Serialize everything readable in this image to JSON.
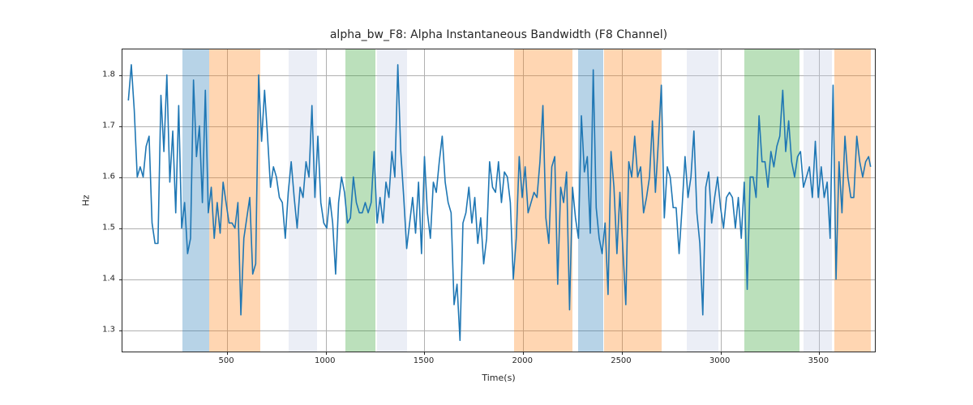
{
  "chart_data": {
    "type": "line",
    "title": "alpha_bw_F8: Alpha Instantaneous Bandwidth (F8 Channel)",
    "xlabel": "Time(s)",
    "ylabel": "Hz",
    "xlim": [
      -30,
      3790
    ],
    "ylim": [
      1.255,
      1.85
    ],
    "xticks": [
      500,
      1000,
      1500,
      2000,
      2500,
      3000,
      3500
    ],
    "yticks": [
      1.3,
      1.4,
      1.5,
      1.6,
      1.7,
      1.8
    ],
    "bands": [
      {
        "start": 275,
        "end": 410,
        "color": "blue"
      },
      {
        "start": 410,
        "end": 670,
        "color": "orange"
      },
      {
        "start": 810,
        "end": 955,
        "color": "lav"
      },
      {
        "start": 1100,
        "end": 1250,
        "color": "green"
      },
      {
        "start": 1260,
        "end": 1410,
        "color": "lav"
      },
      {
        "start": 1955,
        "end": 2250,
        "color": "orange"
      },
      {
        "start": 2280,
        "end": 2405,
        "color": "blue"
      },
      {
        "start": 2410,
        "end": 2700,
        "color": "orange"
      },
      {
        "start": 2830,
        "end": 2990,
        "color": "lav"
      },
      {
        "start": 3120,
        "end": 3400,
        "color": "green"
      },
      {
        "start": 3420,
        "end": 3565,
        "color": "lav"
      },
      {
        "start": 3575,
        "end": 3760,
        "color": "orange"
      }
    ],
    "x": [
      0,
      15,
      30,
      45,
      60,
      75,
      90,
      105,
      120,
      135,
      150,
      165,
      180,
      195,
      210,
      225,
      240,
      255,
      270,
      285,
      300,
      315,
      330,
      345,
      360,
      375,
      390,
      405,
      420,
      435,
      450,
      465,
      480,
      495,
      510,
      525,
      540,
      555,
      570,
      585,
      600,
      615,
      630,
      645,
      660,
      675,
      690,
      705,
      720,
      735,
      750,
      765,
      780,
      795,
      810,
      825,
      840,
      855,
      870,
      885,
      900,
      915,
      930,
      945,
      960,
      975,
      990,
      1005,
      1020,
      1035,
      1050,
      1065,
      1080,
      1095,
      1110,
      1125,
      1140,
      1155,
      1170,
      1185,
      1200,
      1215,
      1230,
      1245,
      1260,
      1275,
      1290,
      1305,
      1320,
      1335,
      1350,
      1365,
      1380,
      1395,
      1410,
      1425,
      1440,
      1455,
      1470,
      1485,
      1500,
      1515,
      1530,
      1545,
      1560,
      1575,
      1590,
      1605,
      1620,
      1635,
      1650,
      1665,
      1680,
      1695,
      1710,
      1725,
      1740,
      1755,
      1770,
      1785,
      1800,
      1815,
      1830,
      1845,
      1860,
      1875,
      1890,
      1905,
      1920,
      1935,
      1950,
      1965,
      1980,
      1995,
      2010,
      2025,
      2040,
      2055,
      2070,
      2085,
      2100,
      2115,
      2130,
      2145,
      2160,
      2175,
      2190,
      2205,
      2220,
      2235,
      2250,
      2265,
      2280,
      2295,
      2310,
      2325,
      2340,
      2355,
      2370,
      2385,
      2400,
      2415,
      2430,
      2445,
      2460,
      2475,
      2490,
      2505,
      2520,
      2535,
      2550,
      2565,
      2580,
      2595,
      2610,
      2625,
      2640,
      2655,
      2670,
      2685,
      2700,
      2715,
      2730,
      2745,
      2760,
      2775,
      2790,
      2805,
      2820,
      2835,
      2850,
      2865,
      2880,
      2895,
      2910,
      2925,
      2940,
      2955,
      2970,
      2985,
      3000,
      3015,
      3030,
      3045,
      3060,
      3075,
      3090,
      3105,
      3120,
      3135,
      3150,
      3165,
      3180,
      3195,
      3210,
      3225,
      3240,
      3255,
      3270,
      3285,
      3300,
      3315,
      3330,
      3345,
      3360,
      3375,
      3390,
      3405,
      3420,
      3435,
      3450,
      3465,
      3480,
      3495,
      3510,
      3525,
      3540,
      3555,
      3570,
      3585,
      3600,
      3615,
      3630,
      3645,
      3660,
      3675,
      3690,
      3705,
      3720,
      3735,
      3750,
      3760
    ],
    "values": [
      1.75,
      1.82,
      1.73,
      1.6,
      1.62,
      1.6,
      1.66,
      1.68,
      1.51,
      1.47,
      1.47,
      1.76,
      1.65,
      1.8,
      1.59,
      1.69,
      1.53,
      1.74,
      1.5,
      1.55,
      1.45,
      1.48,
      1.79,
      1.64,
      1.7,
      1.55,
      1.77,
      1.53,
      1.58,
      1.48,
      1.55,
      1.49,
      1.59,
      1.55,
      1.51,
      1.51,
      1.5,
      1.55,
      1.33,
      1.48,
      1.52,
      1.56,
      1.41,
      1.43,
      1.8,
      1.67,
      1.77,
      1.68,
      1.58,
      1.62,
      1.6,
      1.56,
      1.55,
      1.48,
      1.57,
      1.63,
      1.56,
      1.5,
      1.58,
      1.56,
      1.63,
      1.6,
      1.74,
      1.56,
      1.68,
      1.55,
      1.51,
      1.5,
      1.56,
      1.51,
      1.41,
      1.55,
      1.6,
      1.57,
      1.51,
      1.52,
      1.6,
      1.55,
      1.53,
      1.53,
      1.55,
      1.53,
      1.55,
      1.65,
      1.51,
      1.56,
      1.51,
      1.59,
      1.56,
      1.65,
      1.6,
      1.82,
      1.65,
      1.56,
      1.46,
      1.51,
      1.56,
      1.49,
      1.59,
      1.45,
      1.64,
      1.53,
      1.48,
      1.59,
      1.57,
      1.63,
      1.68,
      1.59,
      1.55,
      1.53,
      1.35,
      1.39,
      1.28,
      1.51,
      1.53,
      1.58,
      1.51,
      1.56,
      1.47,
      1.52,
      1.43,
      1.48,
      1.63,
      1.58,
      1.57,
      1.63,
      1.55,
      1.61,
      1.6,
      1.55,
      1.4,
      1.48,
      1.64,
      1.56,
      1.62,
      1.53,
      1.55,
      1.57,
      1.56,
      1.63,
      1.74,
      1.52,
      1.47,
      1.62,
      1.64,
      1.39,
      1.58,
      1.55,
      1.61,
      1.34,
      1.58,
      1.52,
      1.48,
      1.72,
      1.61,
      1.64,
      1.49,
      1.81,
      1.54,
      1.48,
      1.45,
      1.51,
      1.37,
      1.65,
      1.58,
      1.45,
      1.57,
      1.46,
      1.35,
      1.63,
      1.6,
      1.68,
      1.6,
      1.62,
      1.53,
      1.56,
      1.6,
      1.71,
      1.57,
      1.67,
      1.78,
      1.52,
      1.62,
      1.6,
      1.54,
      1.54,
      1.45,
      1.54,
      1.64,
      1.56,
      1.6,
      1.69,
      1.53,
      1.47,
      1.33,
      1.58,
      1.61,
      1.51,
      1.56,
      1.6,
      1.54,
      1.5,
      1.56,
      1.57,
      1.56,
      1.5,
      1.56,
      1.48,
      1.59,
      1.38,
      1.6,
      1.6,
      1.56,
      1.72,
      1.63,
      1.63,
      1.58,
      1.65,
      1.62,
      1.66,
      1.68,
      1.77,
      1.65,
      1.71,
      1.63,
      1.6,
      1.64,
      1.65,
      1.58,
      1.6,
      1.62,
      1.56,
      1.67,
      1.56,
      1.62,
      1.56,
      1.59,
      1.48,
      1.78,
      1.4,
      1.63,
      1.53,
      1.68,
      1.6,
      1.56,
      1.56,
      1.68,
      1.63,
      1.6,
      1.63,
      1.64,
      1.62
    ]
  }
}
